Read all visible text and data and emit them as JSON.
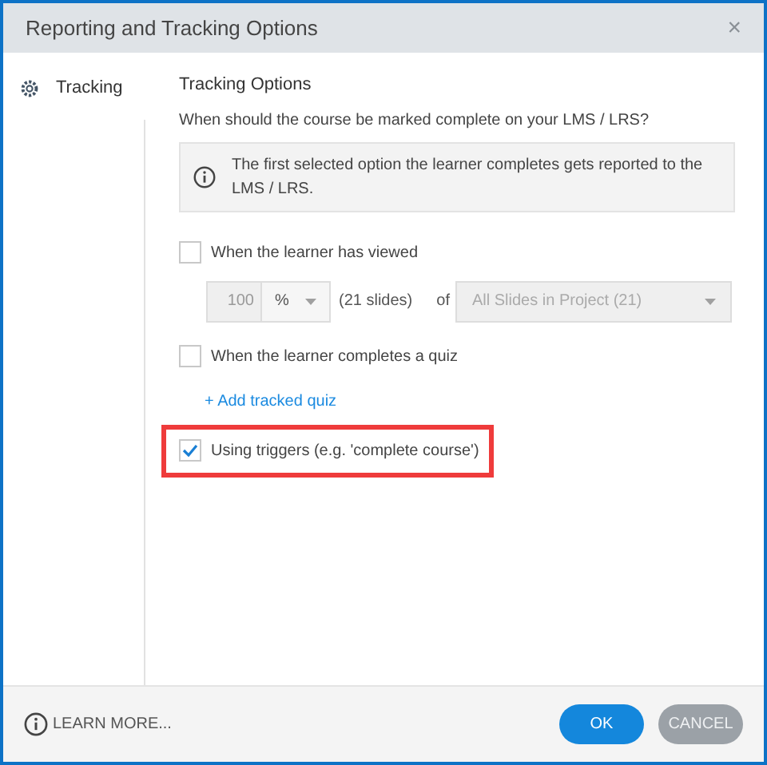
{
  "window": {
    "title": "Reporting and Tracking Options",
    "close": "×"
  },
  "sidebar": {
    "items": [
      {
        "label": "Tracking",
        "selected": true
      }
    ]
  },
  "content": {
    "title": "Tracking Options",
    "question": "When should the course be marked complete on your LMS / LRS?",
    "info": "The first selected option the learner completes gets reported to the LMS / LRS.",
    "options": [
      {
        "kind": "viewed",
        "label": "When the learner has viewed",
        "checked": false,
        "highlighted": false,
        "amount": "100",
        "unit": "%",
        "slides": "(21 slides)",
        "of": "of",
        "scope": "All Slides in Project (21)",
        "disabled": true
      },
      {
        "kind": "quiz",
        "label": "When the learner completes a quiz",
        "checked": false,
        "highlighted": false,
        "link": "+ Add tracked quiz"
      },
      {
        "kind": "plain",
        "label": "Using triggers (e.g. 'complete course')",
        "checked": true,
        "highlighted": true
      }
    ]
  },
  "footer": {
    "learn_more": "LEARN MORE...",
    "buttons": [
      {
        "label": "OK",
        "kind": "primary"
      },
      {
        "label": "CANCEL",
        "kind": "secondary"
      }
    ]
  }
}
